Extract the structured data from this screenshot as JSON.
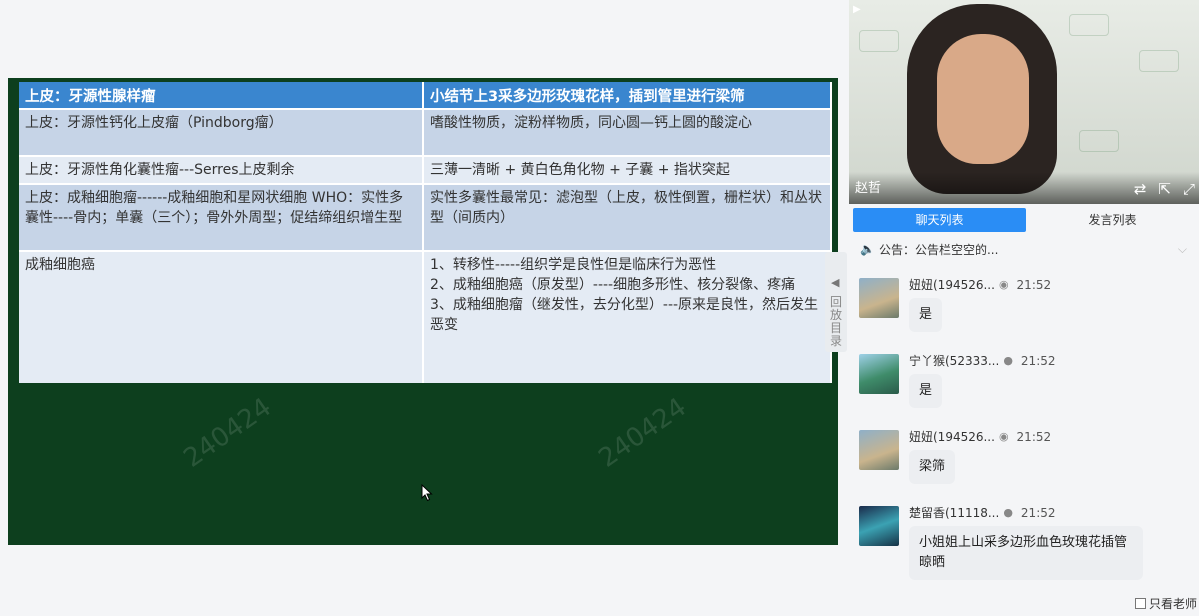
{
  "slide": {
    "header": [
      "上皮：牙源性腺样瘤",
      "小结节上3采多边形玫瑰花样，插到管里进行梁筛"
    ],
    "rows": [
      [
        "上皮：牙源性钙化上皮瘤（Pindborg瘤）",
        "嗜酸性物质，淀粉样物质，同心圆—钙上圆的酸淀心"
      ],
      [
        "上皮：牙源性角化囊性瘤---Serres上皮剩余",
        "三薄一清晰 + 黄白色角化物 + 子囊 + 指状突起"
      ],
      [
        "上皮：成釉细胞瘤------成釉细胞和星网状细胞 WHO：实性多囊性----骨内；单囊（三个）；骨外外周型；促结缔组织增生型",
        "实性多囊性最常见：滤泡型（上皮，极性倒置，栅栏状）和丛状型（间质内）"
      ],
      [
        "成釉细胞癌",
        [
          "1、转移性-----组织学是良性但是临床行为恶性",
          "2、成釉细胞癌（原发型）----细胞多形性、核分裂像、疼痛",
          "3、成釉细胞瘤（继发性，去分化型）---原来是良性，然后发生恶变"
        ]
      ]
    ],
    "watermark": "240424"
  },
  "video": {
    "presenter_name": "赵哲",
    "controls": [
      "swap-icon",
      "popout-icon",
      "fullscreen-icon"
    ]
  },
  "sidebar_scroll": {
    "label": "回放目录"
  },
  "tabs": {
    "chat": "聊天列表",
    "speakers": "发言列表"
  },
  "notice": {
    "text": "公告：公告栏空空的..."
  },
  "messages": [
    {
      "user": "妞妞(194526...",
      "time": "21:52",
      "text": "是",
      "avatar_color": "#6d8aa0"
    },
    {
      "user": "宁丫猴(52333...",
      "time": "21:52",
      "text": "是",
      "avatar_color": "#3f8c6a"
    },
    {
      "user": "妞妞(194526...",
      "time": "21:52",
      "text": "梁筛",
      "avatar_color": "#6d8aa0"
    },
    {
      "user": "楚留香(11118...",
      "time": "21:52",
      "text": "小姐姐上山采多边形血色玫瑰花插管晾晒",
      "avatar_color": "#2b4f6e"
    }
  ],
  "footer": {
    "only_teacher": "只看老师"
  }
}
